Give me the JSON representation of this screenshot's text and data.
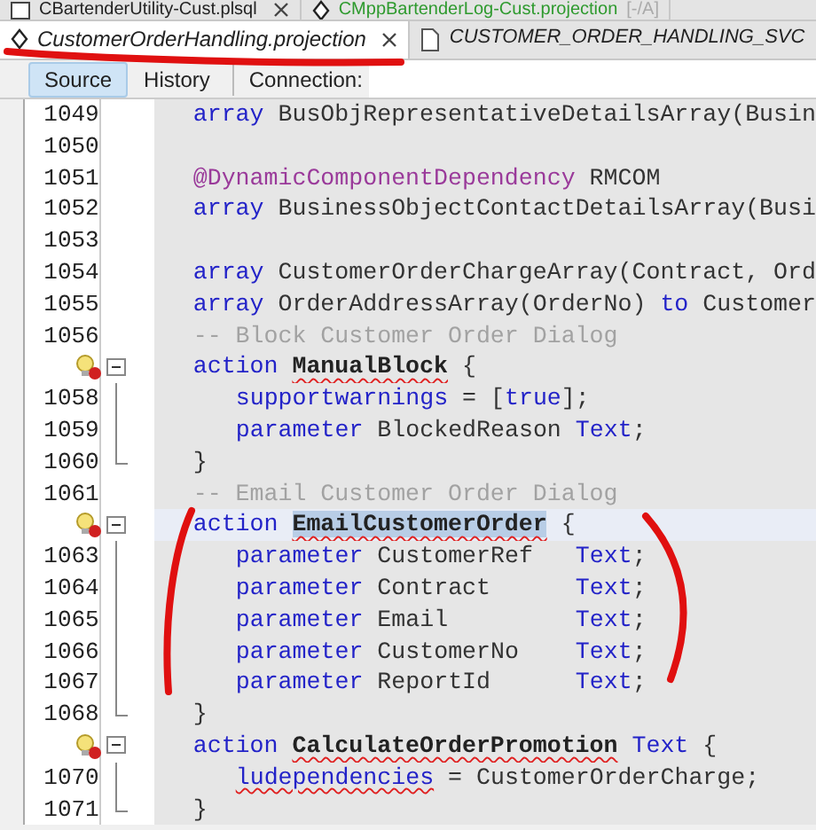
{
  "tab_rows": [
    {
      "tabs": [
        {
          "kind": "plain",
          "label": "CBartenderUtility-Cust.plsql",
          "closable": true,
          "selected": false,
          "modified_style": false
        },
        {
          "kind": "projection",
          "label": "CMppBartenderLog-Cust.projection",
          "suffix": "[-/A]",
          "closable": false,
          "selected": false,
          "modified_style": true
        }
      ]
    },
    {
      "tabs": [
        {
          "kind": "projection",
          "label": "CustomerOrderHandling.projection",
          "closable": true,
          "selected": true,
          "modified_style": false
        },
        {
          "kind": "file",
          "label": "CUSTOMER_ORDER_HANDLING_SVC",
          "closable": false,
          "selected": false,
          "modified_style": false
        }
      ]
    }
  ],
  "toolbar": {
    "buttons": [
      {
        "label": "Source",
        "selected": true
      },
      {
        "label": "History",
        "selected": false
      }
    ],
    "connection_label": "Connection:"
  },
  "editor": {
    "lines": [
      {
        "number": "1049",
        "warning": false,
        "collapsible": false,
        "block_end": false,
        "current": false,
        "tokens": [
          {
            "kind": "keyword",
            "text": "array",
            "error": false,
            "selected": false
          },
          {
            "kind": "text",
            "text": " BusObjRepresentativeDetailsArray(Busin",
            "error": false,
            "selected": false
          }
        ]
      },
      {
        "number": "1050",
        "warning": false,
        "collapsible": false,
        "block_end": false,
        "current": false
      },
      {
        "number": "1051",
        "warning": false,
        "collapsible": false,
        "block_end": false,
        "current": false,
        "tokens": [
          {
            "kind": "annotation",
            "text": "@DynamicComponentDependency",
            "error": false,
            "selected": false
          },
          {
            "kind": "text",
            "text": " RMCOM",
            "error": false,
            "selected": false
          }
        ]
      },
      {
        "number": "1052",
        "warning": false,
        "collapsible": false,
        "block_end": false,
        "current": false,
        "tokens": [
          {
            "kind": "keyword",
            "text": "array",
            "error": false,
            "selected": false
          },
          {
            "kind": "text",
            "text": " BusinessObjectContactDetailsArray(Busi",
            "error": false,
            "selected": false
          }
        ]
      },
      {
        "number": "1053",
        "warning": false,
        "collapsible": false,
        "block_end": false,
        "current": false
      },
      {
        "number": "1054",
        "warning": false,
        "collapsible": false,
        "block_end": false,
        "current": false,
        "tokens": [
          {
            "kind": "keyword",
            "text": "array",
            "error": false,
            "selected": false
          },
          {
            "kind": "text",
            "text": " CustomerOrderChargeArray(Contract, Ord",
            "error": false,
            "selected": false
          }
        ]
      },
      {
        "number": "1055",
        "warning": false,
        "collapsible": false,
        "block_end": false,
        "current": false,
        "tokens": [
          {
            "kind": "keyword",
            "text": "array",
            "error": false,
            "selected": false
          },
          {
            "kind": "text",
            "text": " OrderAddressArray(OrderNo) ",
            "error": false,
            "selected": false
          },
          {
            "kind": "keyword",
            "text": "to",
            "error": false,
            "selected": false
          },
          {
            "kind": "text",
            "text": " Customer",
            "error": false,
            "selected": false
          }
        ]
      },
      {
        "number": "1056",
        "warning": false,
        "collapsible": false,
        "block_end": false,
        "current": false,
        "tokens": [
          {
            "kind": "comment",
            "text": "-- Block Customer Order Dialog",
            "error": false,
            "selected": false
          }
        ]
      },
      {
        "warning": true,
        "collapsible": true,
        "block_end": false,
        "current": false,
        "tokens": [
          {
            "kind": "keyword",
            "text": "action ",
            "error": false,
            "selected": false
          },
          {
            "kind": "name",
            "text": "ManualBlock",
            "error": true,
            "selected": false
          },
          {
            "kind": "text",
            "text": " {",
            "error": false,
            "selected": false
          }
        ],
        "children": [
          {
            "number": "1058",
            "warning": false,
            "collapsible": false,
            "block_end": false,
            "current": false,
            "tokens": [
              {
                "kind": "keyword",
                "text": "supportwarnings",
                "error": false,
                "selected": false
              },
              {
                "kind": "text",
                "text": " = [",
                "error": false,
                "selected": false
              },
              {
                "kind": "keyword",
                "text": "true",
                "error": false,
                "selected": false
              },
              {
                "kind": "text",
                "text": "];",
                "error": false,
                "selected": false
              }
            ]
          },
          {
            "number": "1059",
            "warning": false,
            "collapsible": false,
            "block_end": false,
            "current": false,
            "tokens": [
              {
                "kind": "keyword",
                "text": "parameter",
                "error": false,
                "selected": false
              },
              {
                "kind": "text",
                "text": " BlockedReason ",
                "error": false,
                "selected": false
              },
              {
                "kind": "keyword",
                "text": "Text",
                "error": false,
                "selected": false
              },
              {
                "kind": "text",
                "text": ";",
                "error": false,
                "selected": false
              }
            ]
          }
        ]
      },
      {
        "number": "1060",
        "warning": false,
        "collapsible": false,
        "block_end": true,
        "current": false,
        "tokens": [
          {
            "kind": "text",
            "text": "}",
            "error": false,
            "selected": false
          }
        ]
      },
      {
        "number": "1061",
        "warning": false,
        "collapsible": false,
        "block_end": false,
        "current": false,
        "tokens": [
          {
            "kind": "comment",
            "text": "-- Email Customer Order Dialog",
            "error": false,
            "selected": false
          }
        ]
      },
      {
        "warning": true,
        "collapsible": true,
        "block_end": false,
        "current": true,
        "tokens": [
          {
            "kind": "keyword",
            "text": "action ",
            "error": false,
            "selected": false
          },
          {
            "kind": "name",
            "text": "EmailCustomerOrder",
            "error": true,
            "selected": true
          },
          {
            "kind": "text",
            "text": " {",
            "error": false,
            "selected": false
          }
        ],
        "children": [
          {
            "number": "1063",
            "warning": false,
            "collapsible": false,
            "block_end": false,
            "current": false,
            "tokens": [
              {
                "kind": "keyword",
                "text": "parameter",
                "error": false,
                "selected": false
              },
              {
                "kind": "text",
                "text": " CustomerRef   ",
                "error": false,
                "selected": false
              },
              {
                "kind": "keyword",
                "text": "Text",
                "error": false,
                "selected": false
              },
              {
                "kind": "text",
                "text": ";",
                "error": false,
                "selected": false
              }
            ]
          },
          {
            "number": "1064",
            "warning": false,
            "collapsible": false,
            "block_end": false,
            "current": false,
            "tokens": [
              {
                "kind": "keyword",
                "text": "parameter",
                "error": false,
                "selected": false
              },
              {
                "kind": "text",
                "text": " Contract      ",
                "error": false,
                "selected": false
              },
              {
                "kind": "keyword",
                "text": "Text",
                "error": false,
                "selected": false
              },
              {
                "kind": "text",
                "text": ";",
                "error": false,
                "selected": false
              }
            ]
          },
          {
            "number": "1065",
            "warning": false,
            "collapsible": false,
            "block_end": false,
            "current": false,
            "tokens": [
              {
                "kind": "keyword",
                "text": "parameter",
                "error": false,
                "selected": false
              },
              {
                "kind": "text",
                "text": " Email         ",
                "error": false,
                "selected": false
              },
              {
                "kind": "keyword",
                "text": "Text",
                "error": false,
                "selected": false
              },
              {
                "kind": "text",
                "text": ";",
                "error": false,
                "selected": false
              }
            ]
          },
          {
            "number": "1066",
            "warning": false,
            "collapsible": false,
            "block_end": false,
            "current": false,
            "tokens": [
              {
                "kind": "keyword",
                "text": "parameter",
                "error": false,
                "selected": false
              },
              {
                "kind": "text",
                "text": " CustomerNo    ",
                "error": false,
                "selected": false
              },
              {
                "kind": "keyword",
                "text": "Text",
                "error": false,
                "selected": false
              },
              {
                "kind": "text",
                "text": ";",
                "error": false,
                "selected": false
              }
            ]
          },
          {
            "number": "1067",
            "warning": false,
            "collapsible": false,
            "block_end": false,
            "current": false,
            "tokens": [
              {
                "kind": "keyword",
                "text": "parameter",
                "error": false,
                "selected": false
              },
              {
                "kind": "text",
                "text": " ReportId      ",
                "error": false,
                "selected": false
              },
              {
                "kind": "keyword",
                "text": "Text",
                "error": false,
                "selected": false
              },
              {
                "kind": "text",
                "text": ";",
                "error": false,
                "selected": false
              }
            ]
          }
        ]
      },
      {
        "number": "1068",
        "warning": false,
        "collapsible": false,
        "block_end": true,
        "current": false,
        "tokens": [
          {
            "kind": "text",
            "text": "}",
            "error": false,
            "selected": false
          }
        ]
      },
      {
        "warning": true,
        "collapsible": true,
        "block_end": false,
        "current": false,
        "tokens": [
          {
            "kind": "keyword",
            "text": "action ",
            "error": false,
            "selected": false
          },
          {
            "kind": "name",
            "text": "CalculateOrderPromotion",
            "error": true,
            "selected": false
          },
          {
            "kind": "keyword",
            "text": " Text",
            "error": false,
            "selected": false
          },
          {
            "kind": "text",
            "text": " {",
            "error": false,
            "selected": false
          }
        ],
        "children": [
          {
            "number": "1070",
            "warning": false,
            "collapsible": false,
            "block_end": false,
            "current": false,
            "tokens": [
              {
                "kind": "keyword",
                "text": "ludependencies",
                "error": true,
                "selected": false
              },
              {
                "kind": "text",
                "text": " = CustomerOrderCharge;",
                "error": false,
                "selected": false
              }
            ]
          }
        ]
      },
      {
        "number": "1071",
        "warning": false,
        "collapsible": false,
        "block_end": true,
        "current": false,
        "tokens": [
          {
            "kind": "text",
            "text": "}",
            "error": false,
            "selected": false
          }
        ]
      }
    ]
  },
  "annotations": [
    {
      "kind": "underline"
    },
    {
      "kind": "left-bracket"
    },
    {
      "kind": "right-bracket"
    }
  ]
}
